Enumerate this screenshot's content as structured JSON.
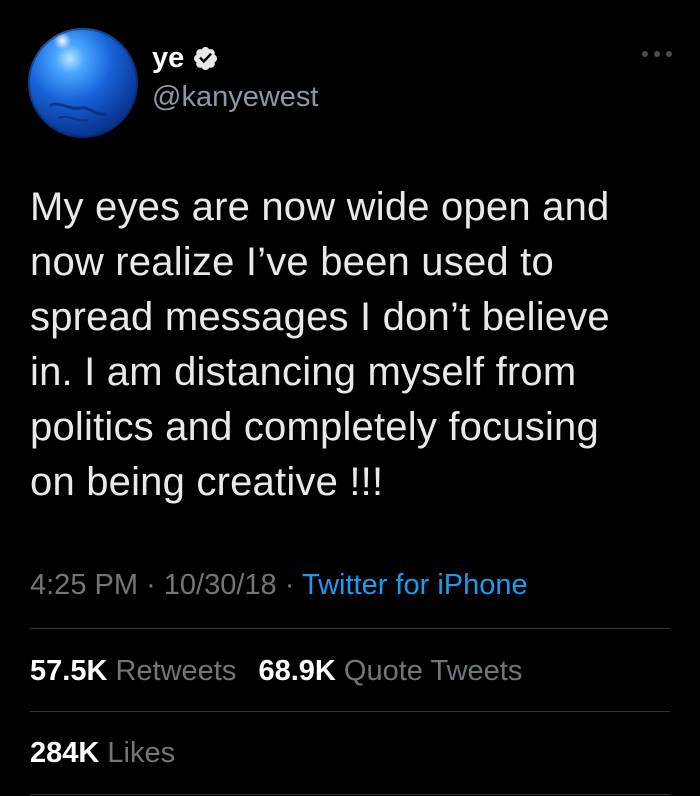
{
  "user": {
    "display_name": "ye",
    "handle": "@kanyewest",
    "verified_icon": "verified-badge-icon",
    "more_icon": "more-options-icon"
  },
  "tweet": {
    "text": "My eyes are now wide open and\nnow realize I’ve been used to\nspread messages I don’t believe\nin. I am distancing myself from\npolitics and completely focusing\non being creative !!!",
    "time": "4:25 PM",
    "date": "10/30/18",
    "separator": "·",
    "source": "Twitter for iPhone"
  },
  "stats": {
    "retweets_count": "57.5K",
    "retweets_label": "Retweets",
    "quotes_count": "68.9K",
    "quotes_label": "Quote Tweets",
    "likes_count": "284K",
    "likes_label": "Likes"
  },
  "colors": {
    "background": "#000000",
    "text": "#e7e9ea",
    "muted": "#71767b",
    "link": "#1d9bf0",
    "divider": "#2f3336"
  }
}
